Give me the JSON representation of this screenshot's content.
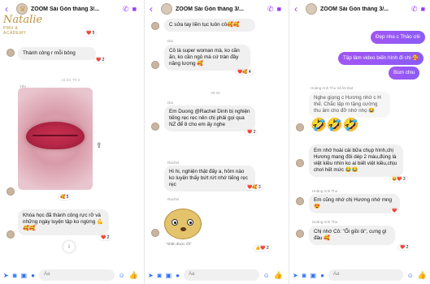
{
  "chat_title": "ZOOM Sài Gòn tháng 3/...",
  "composer_placeholder": "Aa",
  "panel1": {
    "logo_name": "Natalie",
    "logo_sub": "PMU & ACADEMY",
    "msg_top": "Thành công r mỗi bông",
    "react_top": "5",
    "time": "21:34, Th 2",
    "sender_label": "Yến",
    "photo_react": "5",
    "msg_bottom": "Khóa học đã thành công rực rỡ và những ngày luyện tập ko ngừng 💪🥰🥰",
    "react_bottom": "2"
  },
  "panel2": {
    "msg1": "C sửa tay liền tục luôn cô🥰🥰",
    "sender1": "Dai",
    "msg2": "Cô là super woman mà, ko cần ăn, ko cần ngủ mà cứ tràn đầy năng lượng 🥰",
    "react2": "4",
    "time": "09:25",
    "sender3": "Dai",
    "msg3": "Em Duong @Rachel Dinh bị nghiện tiếng rẹc rẹc nên chị phải gọi qua NZ để 8 cho em ấy nghe",
    "react3": "2",
    "sender4": "Rachel",
    "msg4": "Hi hi, nghiện thật đấy a, hôm nào ko luyện thấy bứt rứt nhớ tiếng rẹc rẹc",
    "react4": "3",
    "sender5": "Rachel",
    "sticker_caption": "\"nhân được rồi\"",
    "react5": "2"
  },
  "panel3": {
    "me1": "Đẹp nha c Thảo ơiii",
    "me2": "Tập làm video biến hình đi chị 🥰",
    "me3": "Bùm chiu",
    "reply_label": "Hoàng Anh Thu trả lời Đạt",
    "reply_quote": "Nghe giọng c Hương nhớ c H thế. Chắc lập m tặng cường thu âm cho đỡ nhớ nhọ 😂",
    "emojis": "🤣🤣🤣",
    "msg4": "Em nhớ hoài cái bữa chụp hình,chị Hương mang đôi dép 2 màu,đúng là việt kiều nhìn ko ai biết việt kiều,chịu chơi hết mức 😂😂",
    "react4": "3",
    "sender5": "Hoàng Anh Thu",
    "msg5": "Em cũng nhớ chị Hương nhớ mng 😍",
    "sender6": "Hoàng Anh Thu",
    "msg6": "Chị nhớ Cô: \"Ối giồi ôi\", cưng gì đâu 🥰",
    "react6": "2"
  },
  "colors": {
    "accent": "#9b3bff",
    "me_bubble": "#a155f2",
    "other_bubble": "#f0f0f0",
    "composer_icon": "#2b6fff"
  }
}
